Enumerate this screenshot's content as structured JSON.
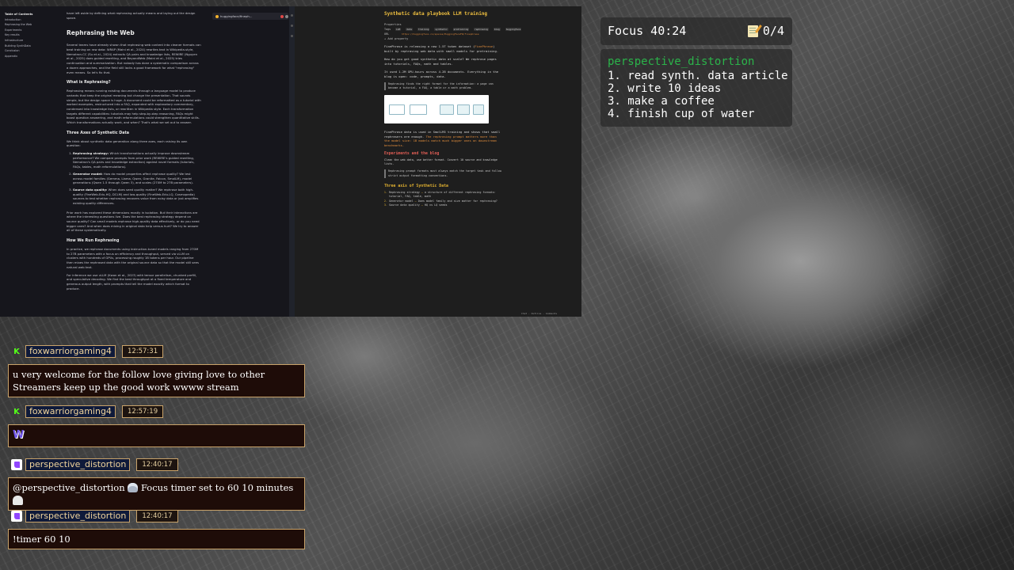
{
  "article": {
    "toc_title": "Table of Contents",
    "toc_items": [
      "Introduction",
      "Rephrasing the Web",
      "Experiments",
      "Key results",
      "Infrastructure",
      "Building SynthData",
      "Conclusion",
      "Appendix"
    ],
    "intro_text": "have left aside by defining what rephrasing actually means and laying out the design space.",
    "h2": "Rephrasing the Web",
    "p1": "Several teams have already shown that rephrasing web content into cleaner formats can beat training on raw data: WRAP (Maini et al., 2024) rewrites text in Wikipedia-style, Nemotron-CC (Su et al., 2024) extracts QA pairs and knowledge lists, REWIRE (Nguyen et al., 2025) does guided rewriting, and BeyondWeb (Maini et al., 2025) tries continuation and summarization. But nobody has done a systematic comparison across a dozen approaches, and the field still lacks a good framework for what \"rephrasing\" even means. So let's fix that.",
    "h3a": "What is Rephrasing?",
    "p2": "Rephrasing means running existing documents through a language model to produce variants that keep the original meaning but change the presentation. That sounds simple, but the design space is huge. A document could be reformatted as a tutorial with worked examples, restructured into a FAQ, expanded with explanatory commentary, condensed into knowledge lists, or rewritten in Wikipedia style. Each transformation targets different capabilities: tutorials may help step-by-step reasoning, FAQs might boost question answering, and math reformulations could strengthen quantitative skills. Which transformations actually work, and when? That's what we set out to answer.",
    "h3b": "Three Axes of Synthetic Data",
    "p3": "We think about synthetic data generation along three axes, each raising its own question:",
    "list": [
      {
        "term": "Rephrasing strategy:",
        "text": "Which transformations actually improve downstream performance? We compare prompts from prior work (REWIRE's guided rewriting, Nemotron's QA pairs and knowledge extraction) against novel formats (tutorials, FAQs, tables, math reformulations)."
      },
      {
        "term": "Generator model:",
        "text": "How do model properties affect rephrase quality? We test across model families (Gemma, Llama, Qwen, Granite, Falcon, SmolLM), model generations (Qwen 1.5 through Qwen 3), and scales (270M to 27B parameters)."
      },
      {
        "term": "Source data quality:",
        "text": "When does seed quality matter? We rephrase both high-quality (FineWeb-Edu-HQ, DCLM) and low-quality (FineWeb-Edu-LQ, Cosmopedia) sources to test whether rephrasing recovers value from noisy data or just amplifies existing quality differences."
      }
    ],
    "p4": "Prior work has explored these dimensions mostly in isolation. But their interactions are where the interesting questions live. Does the best rephrasing strategy depend on source quality? Can small models rephrase high-quality data effectively, or do you need bigger ones? And when does mixing in original data help versus hurt? We try to answer all of these systematically.",
    "h3c": "How We Run Rephrasing",
    "p5": "In practice, we rephrase documents using instruction-tuned models ranging from 270M to 27B parameters with a focus on efficiency and throughput, served via vLLM on clusters with hundreds of GPUs, processing roughly 1B tokens per hour. Our pipeline then mixes the rephrased data with the original source data so that the model still sees natural web text.",
    "p6": "For inference we use vLLM (Kwon et al., 2023) with tensor parallelism, chunked prefill, and speculative decoding. We find the best throughput at a fixed temperature and generous output length, with prompts that tell the model exactly which format to produce.",
    "tab_title": "huggingface/fineph..."
  },
  "training": {
    "title": "Synthetic data playbook LLM training",
    "properties_label": "Properties",
    "tags_key": "Tags",
    "tags": [
      "LLM",
      "data",
      "training",
      "synthetic",
      "pretraining",
      "rephrasing",
      "blog",
      "huggingface"
    ],
    "url_key": "URL",
    "url": "https://huggingface.co/spaces/HuggingFaceFW/finephrase",
    "add_property": "+ Add property",
    "p1": "FinePhrase is releasing a new 1.5T token dataset (",
    "p1_hl": "FinePhrase",
    "p1_end": ") built by rephrasing web data with small models for pretraining.",
    "p2": "How do you get good synthetic data at scale? We rephrase pages into tutorials, FAQs, math and tables.",
    "p3": "It used 1.2M GPU-hours across 4.2B documents. Everything in the blog is open: code, prompts, data.",
    "quote": "Rephrasing finds the right format for the information: a page can become a tutorial, a FAQ, a table or a math problem.",
    "p4": "FinePhrase data is used in SmolLM3 training and shows that small rephrasers are enough.",
    "p4_hl": "The rephrasing prompt matters more than the model size: 1B models match much bigger ones on downstream benchmarks.",
    "h_red": "Experiments and the blog",
    "p5": "Clean the web data, use better format. Convert 10 source and knowledge lists.",
    "quote2": "Rephrasing prompt formats must always match the target task and follow strict output formatting conventions.",
    "h_yellow": "Three axis of Synthetic Data",
    "axes": [
      {
        "name": "Rephrasing strategy",
        "detail": "a structure of different rephrasing formats: tutorial, FAQ, table, math"
      },
      {
        "name": "Generator model",
        "detail": "Does model family and size matter for rephrasing?"
      },
      {
        "name": "Source data quality",
        "detail": "HQ vs LQ seeds"
      }
    ],
    "footer": "Chat · Outline · Comments"
  },
  "focus": {
    "timer": "Focus 40:24",
    "count": "0/4",
    "user": "perspective_distortion",
    "tasks": [
      "1. read synth. data article",
      "2. write 10 ideas",
      "3. make a coffee",
      "4. finish cup of water"
    ]
  },
  "chat": [
    {
      "platform": "kick",
      "user": "foxwarriorgaming4",
      "time": "12:57:31",
      "message": "u very welcome for the follow love giving love to other Streamers keep up the good work wwww stream"
    },
    {
      "platform": "kick",
      "user": "foxwarriorgaming4",
      "time": "12:57:19",
      "message": "W"
    },
    {
      "platform": "twitch",
      "user": "perspective_distortion",
      "time": "12:40:17",
      "message": "@perspective_distortion",
      "message2": "Focus timer set to 60 10 minutes"
    },
    {
      "platform": "twitch",
      "user": "perspective_distortion",
      "time": "12:40:17",
      "message": "!timer 60 10"
    }
  ]
}
